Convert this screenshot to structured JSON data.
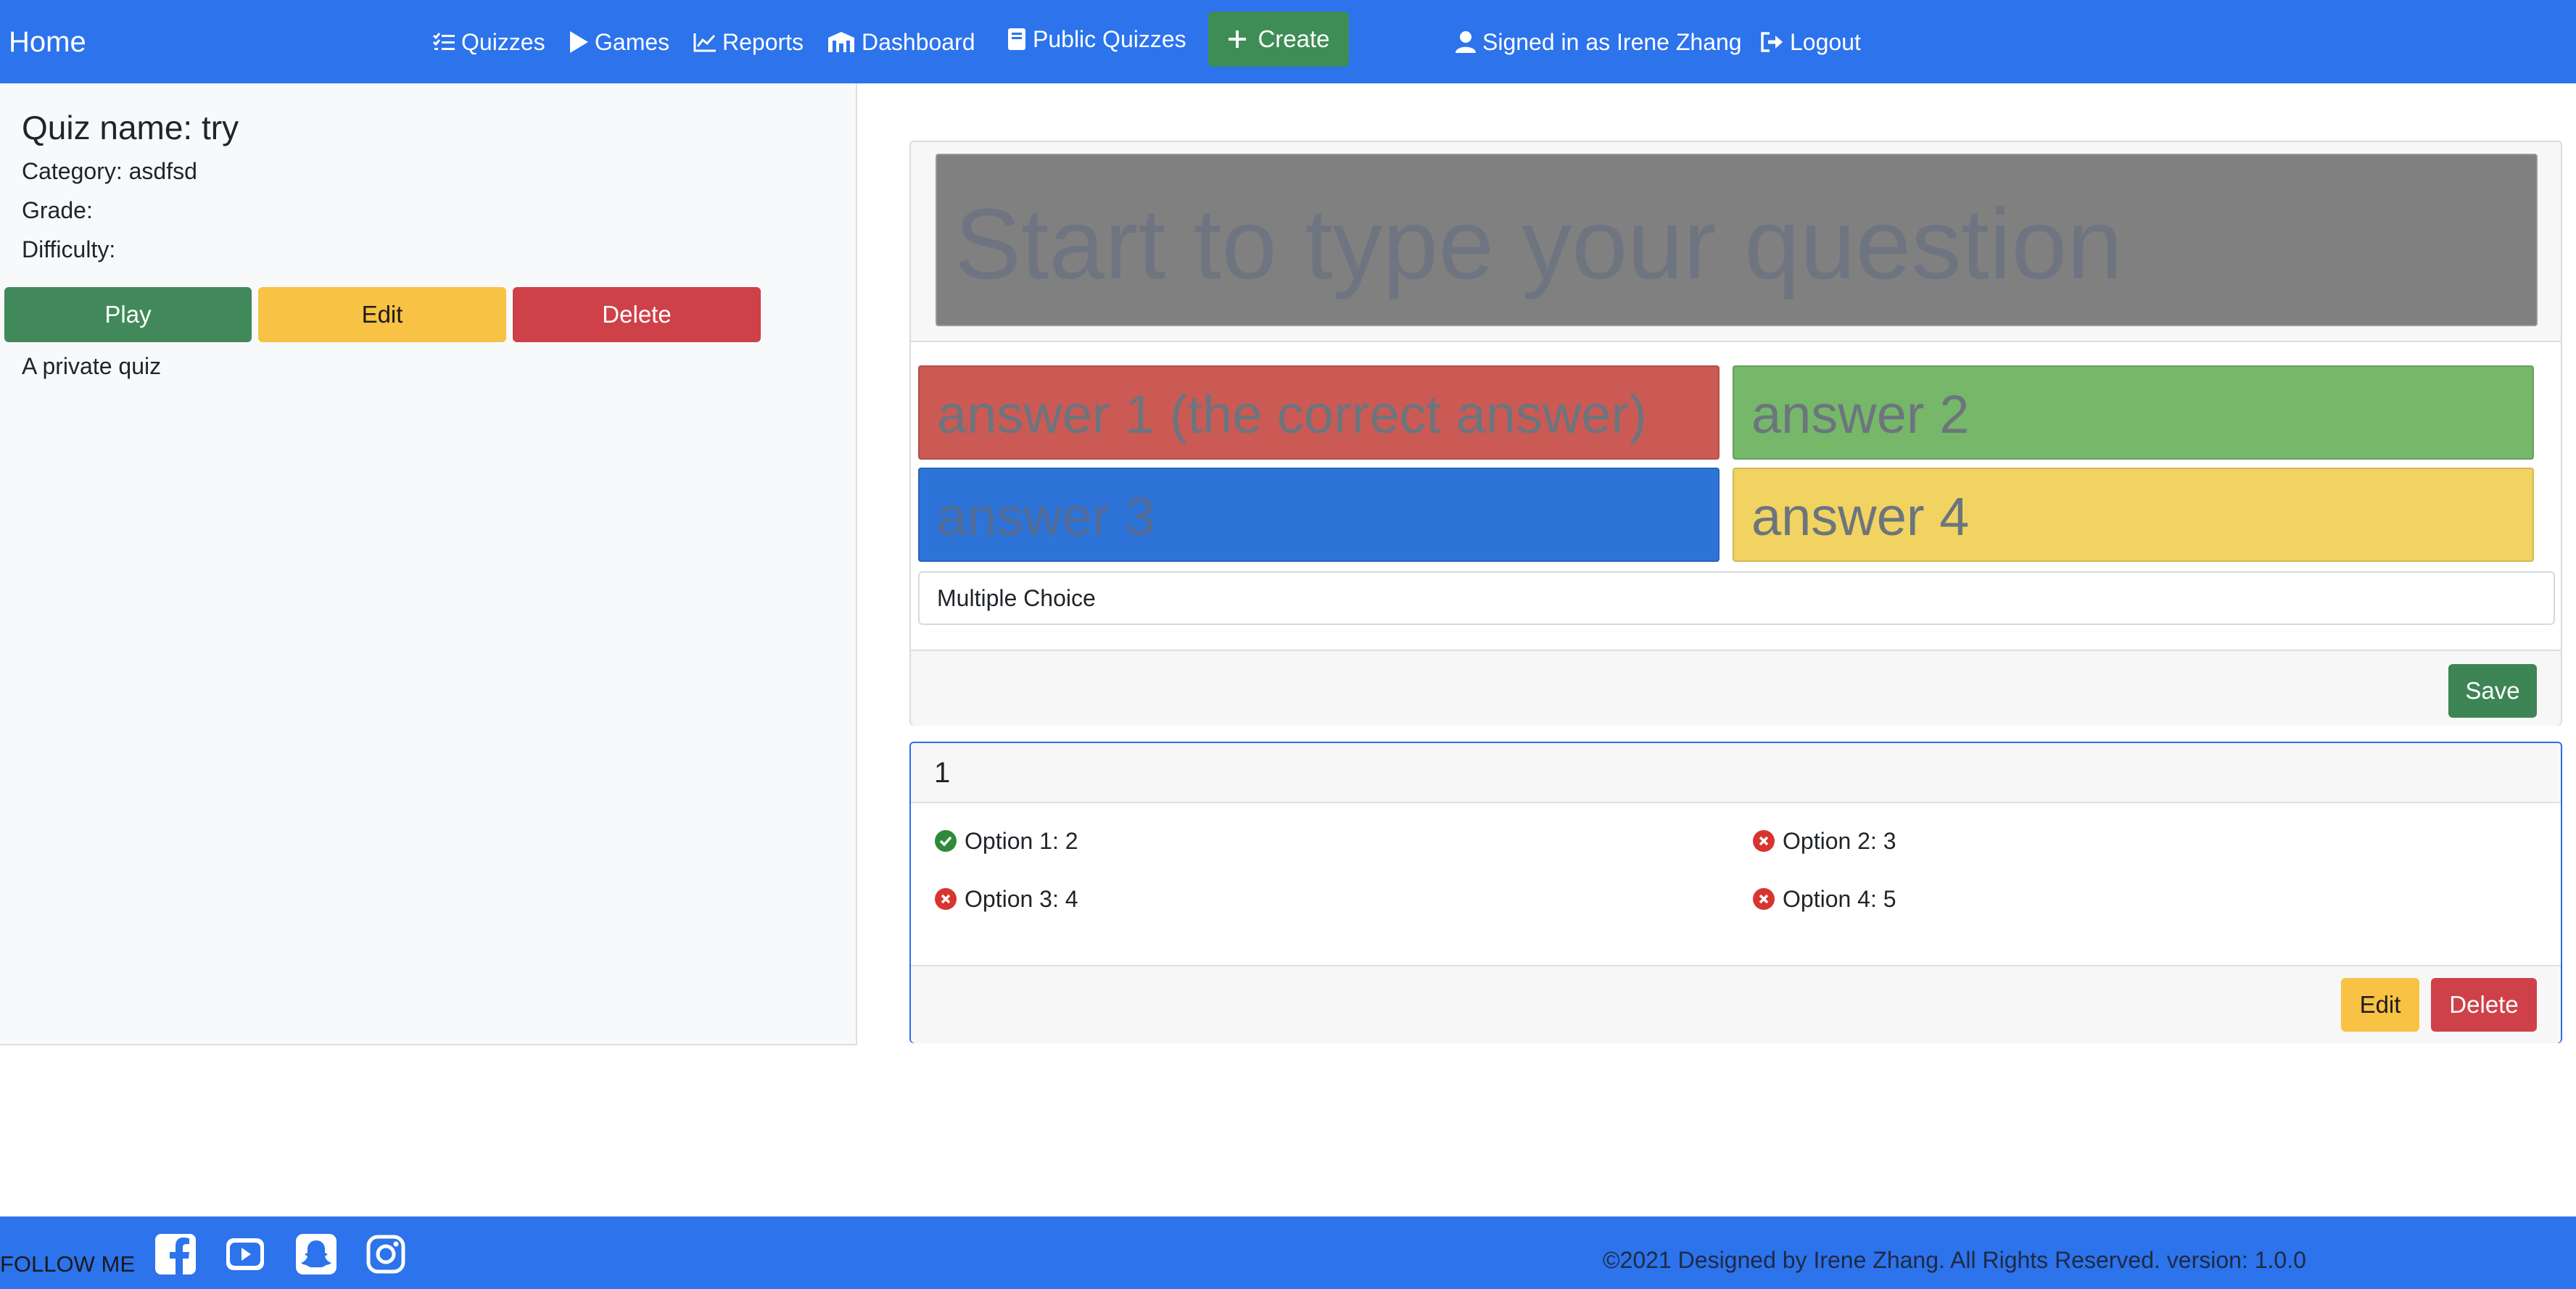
{
  "colors": {
    "primary": "#2c73ec",
    "success": "#41895a",
    "warning": "#f8c245",
    "danger": "#cf4149",
    "answer1": "#cb5a55",
    "answer2": "#76b76a",
    "answer3": "#2e74d8",
    "answer4": "#f1d361"
  },
  "navbar": {
    "brand": "Home",
    "items": [
      {
        "label": "Quizzes",
        "icon": "checklist-icon"
      },
      {
        "label": "Games",
        "icon": "play-icon"
      },
      {
        "label": "Reports",
        "icon": "chart-line-icon"
      },
      {
        "label": "Dashboard",
        "icon": "building-icon"
      },
      {
        "label": "Public Quizzes",
        "icon": "book-icon"
      }
    ],
    "create_label": "Create",
    "user_label": "Signed in as Irene Zhang",
    "logout_label": "Logout"
  },
  "quiz": {
    "title": "Quiz name: try",
    "category": "Category: asdfsd",
    "grade": "Grade:",
    "difficulty": "Difficulty:",
    "play_label": "Play",
    "edit_label": "Edit",
    "delete_label": "Delete",
    "visibility_note": "A private quiz"
  },
  "editor": {
    "question_placeholder": "Start to type your question",
    "answers": [
      {
        "placeholder": "answer 1 (the correct answer)"
      },
      {
        "placeholder": "answer 2"
      },
      {
        "placeholder": "answer 3"
      },
      {
        "placeholder": "answer 4"
      }
    ],
    "question_type": "Multiple Choice",
    "save_label": "Save"
  },
  "question_card": {
    "number": "1",
    "options": [
      {
        "text": "Option 1: 2",
        "correct": true
      },
      {
        "text": "Option 2: 3",
        "correct": false
      },
      {
        "text": "Option 3: 4",
        "correct": false
      },
      {
        "text": "Option 4: 5",
        "correct": false
      }
    ],
    "edit_label": "Edit",
    "delete_label": "Delete"
  },
  "footer": {
    "follow_label": "FOLLOW ME",
    "socials": [
      "facebook-icon",
      "youtube-icon",
      "snapchat-icon",
      "instagram-icon"
    ],
    "copyright": "©2021 Designed by Irene Zhang. All Rights Reserved. version: 1.0.0"
  }
}
